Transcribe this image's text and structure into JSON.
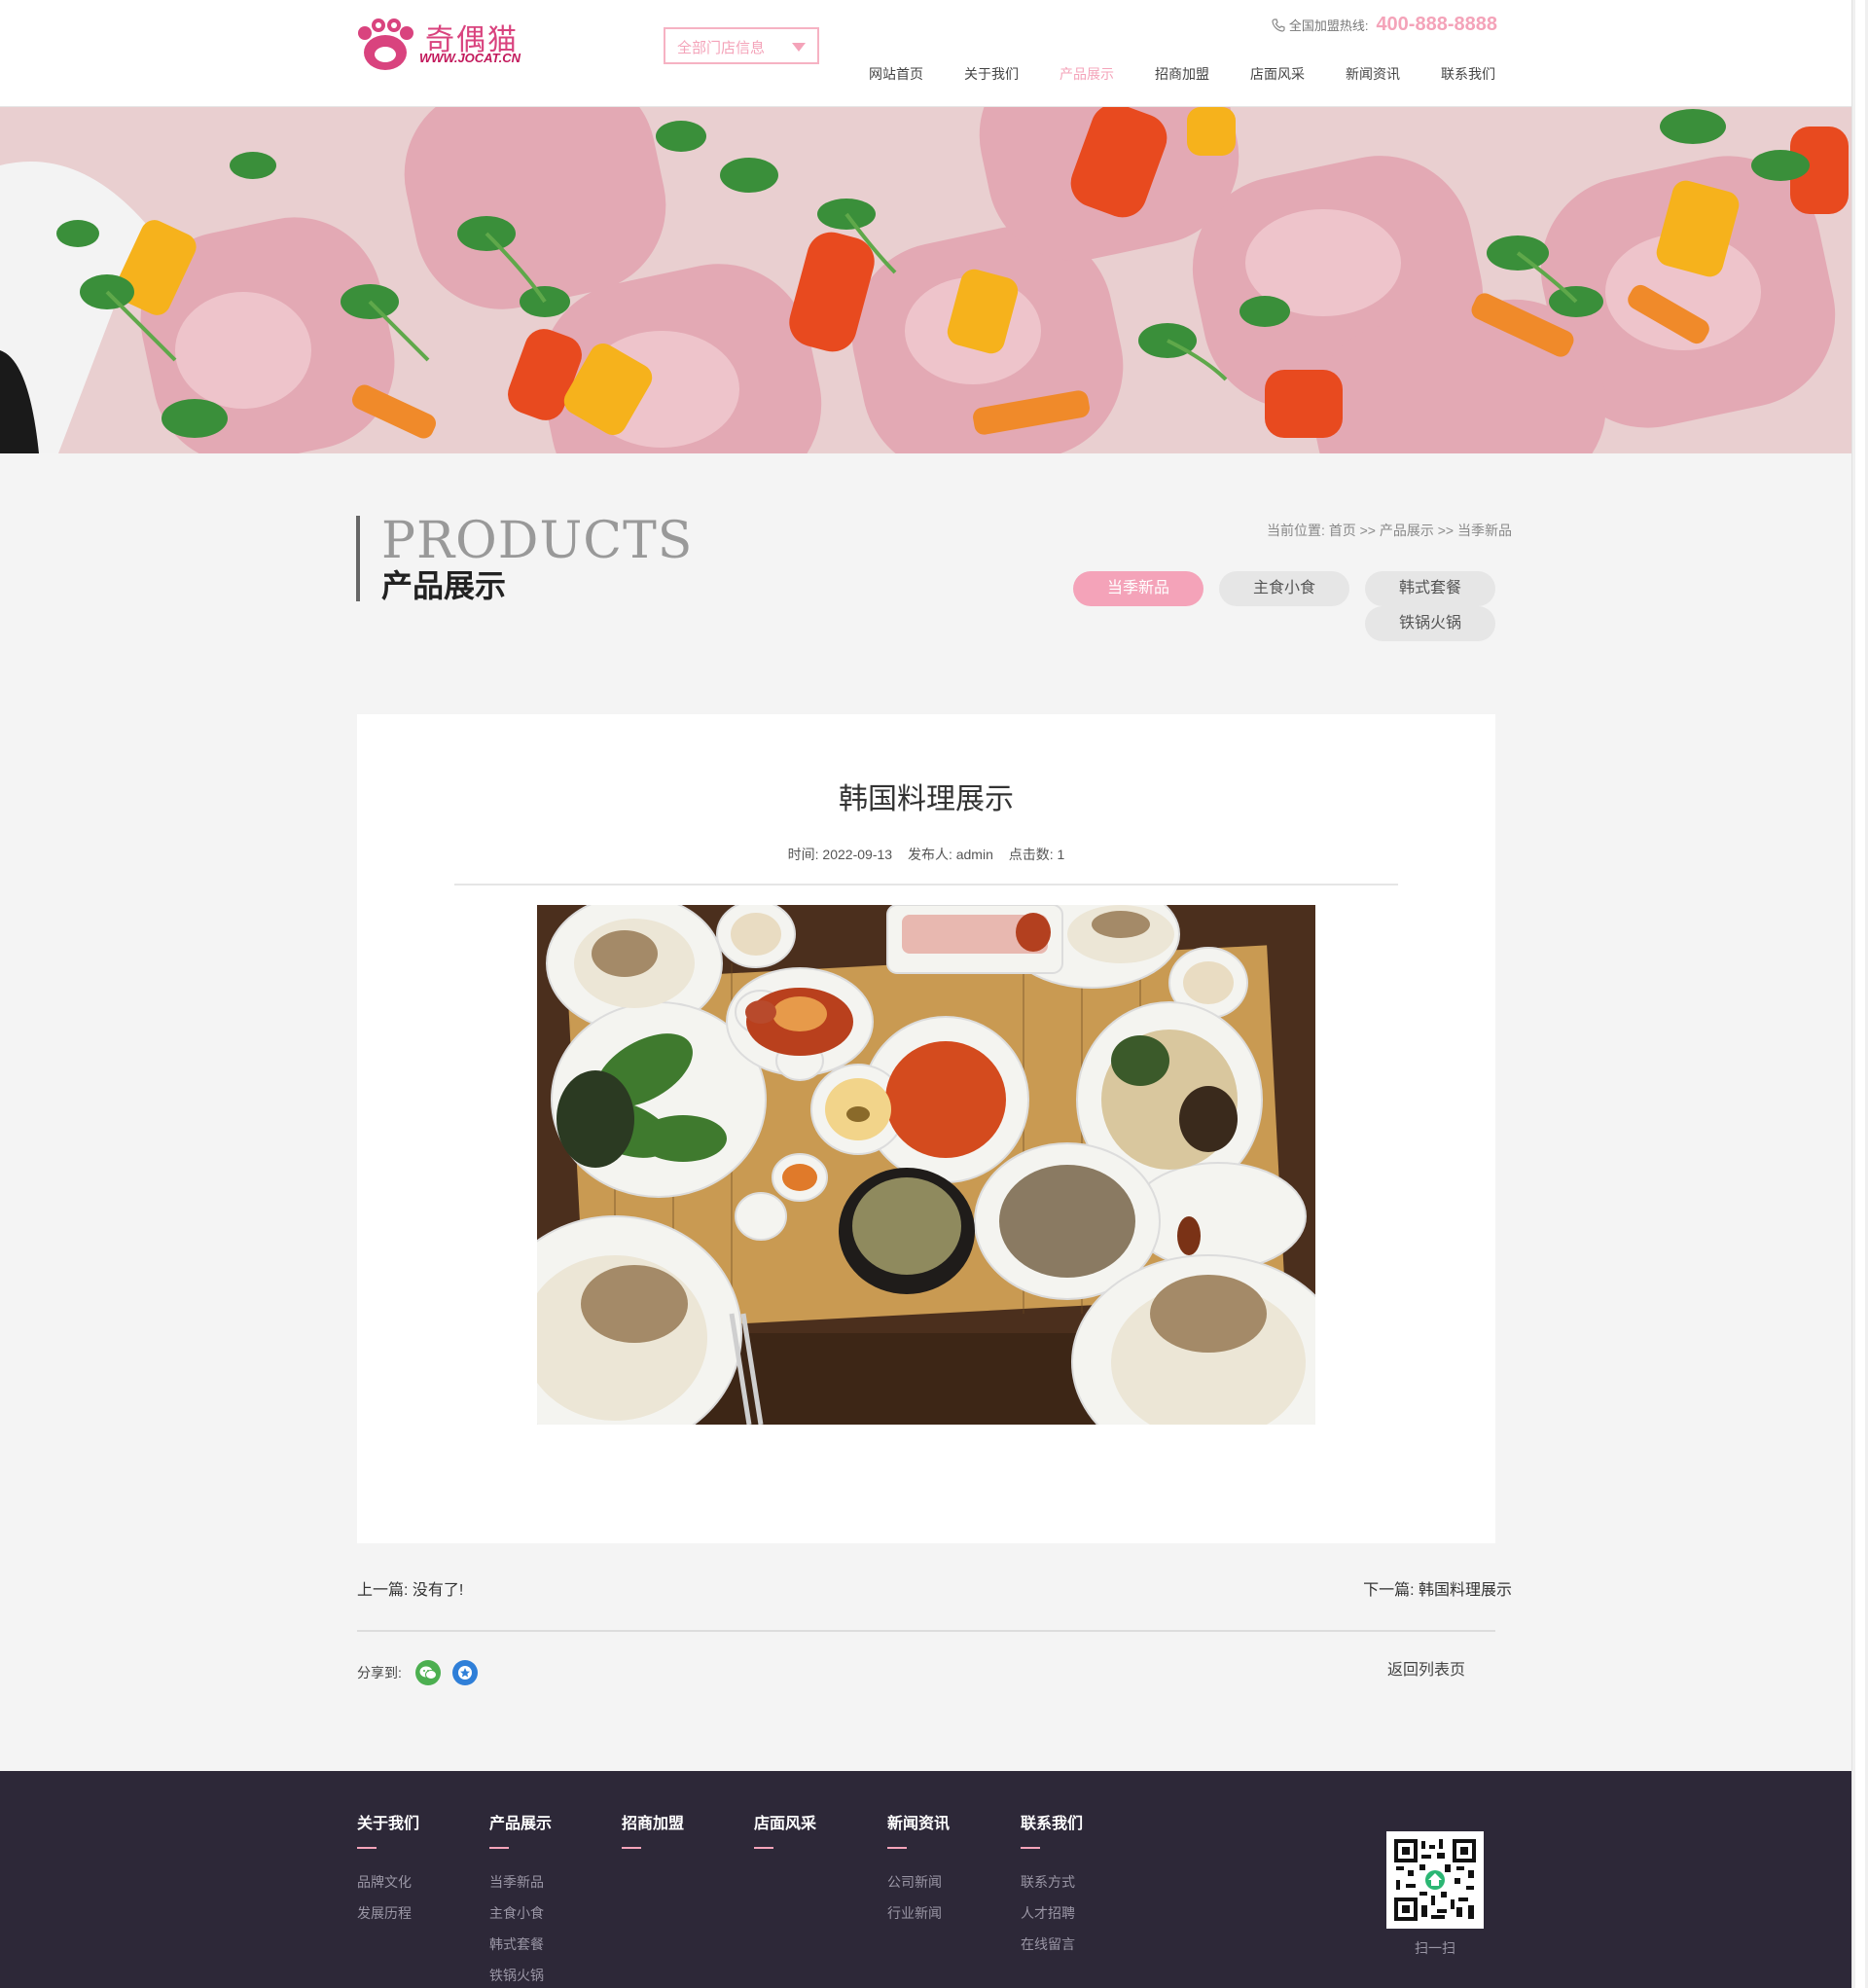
{
  "header": {
    "logo_text": "奇偶猫",
    "logo_url": "WWW.JOCAT.CN",
    "store_select": "全部门店信息",
    "hotline_label": "全国加盟热线:",
    "hotline_number": "400-888-8888",
    "nav": [
      "网站首页",
      "关于我们",
      "产品展示",
      "招商加盟",
      "店面风采",
      "新闻资讯",
      "联系我们"
    ],
    "nav_active_index": 2
  },
  "page_title": {
    "en": "PRODUCTS",
    "cn": "产品展示"
  },
  "breadcrumb": "当前位置: 首页 >> 产品展示 >> 当季新品",
  "tabs": [
    "当季新品",
    "主食小食",
    "韩式套餐",
    "铁锅火锅"
  ],
  "tabs_active_index": 0,
  "article": {
    "title": "韩国料理展示",
    "time": "时间: 2022-09-13",
    "author": "发布人: admin",
    "hits": "点击数: 1"
  },
  "prev": "上一篇: 没有了!",
  "next": "下一篇: 韩国料理展示",
  "share_label": "分享到:",
  "share_icons": [
    "wechat-icon",
    "favorite-star-icon"
  ],
  "back_to_list": "返回列表页",
  "footer": {
    "columns": [
      {
        "title": "关于我们",
        "links": [
          "品牌文化",
          "发展历程"
        ]
      },
      {
        "title": "产品展示",
        "links": [
          "当季新品",
          "主食小食",
          "韩式套餐",
          "铁锅火锅"
        ]
      },
      {
        "title": "招商加盟",
        "links": []
      },
      {
        "title": "店面风采",
        "links": []
      },
      {
        "title": "新闻资讯",
        "links": [
          "公司新闻",
          "行业新闻"
        ]
      },
      {
        "title": "联系我们",
        "links": [
          "联系方式",
          "人才招聘",
          "在线留言"
        ]
      }
    ],
    "qr_label": "扫一扫"
  },
  "colors": {
    "accent_pink": "#f4a3b9",
    "footer_bg": "#2d2838",
    "page_bg": "#f4f4f4"
  }
}
